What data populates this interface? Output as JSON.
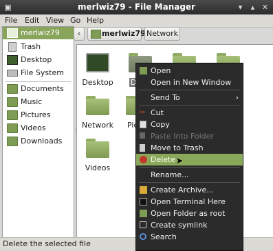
{
  "window": {
    "title": "merlwiz79 - File Manager"
  },
  "menubar": {
    "items": [
      "File",
      "Edit",
      "View",
      "Go",
      "Help"
    ]
  },
  "sidebar": {
    "places": [
      {
        "label": "merlwiz79",
        "icon": "home-icon",
        "selected": true
      },
      {
        "label": "Trash",
        "icon": "trash-icon"
      },
      {
        "label": "Desktop",
        "icon": "desktop-icon"
      },
      {
        "label": "File System",
        "icon": "drive-icon"
      }
    ],
    "bookmarks": [
      {
        "label": "Documents",
        "icon": "folder-icon"
      },
      {
        "label": "Music",
        "icon": "folder-icon"
      },
      {
        "label": "Pictures",
        "icon": "folder-icon"
      },
      {
        "label": "Videos",
        "icon": "folder-icon"
      },
      {
        "label": "Downloads",
        "icon": "folder-icon"
      }
    ]
  },
  "toolbar": {
    "back_icon": "chevron-left-icon",
    "path_current": "merlwiz79",
    "path_other": "Network"
  },
  "main": {
    "items": [
      {
        "label": "Desktop",
        "icon": "desktop-icon"
      },
      {
        "label": "Docu",
        "icon": "folder-icon"
      },
      {
        "label": "",
        "icon": "folder-icon"
      },
      {
        "label": "",
        "icon": "folder-icon"
      },
      {
        "label": "Network",
        "icon": "folder-icon"
      },
      {
        "label": "Pic",
        "icon": "folder-icon"
      },
      {
        "label": "s",
        "icon": "folder-icon"
      },
      {
        "label": "Videos",
        "icon": "folder-icon"
      }
    ]
  },
  "context_menu": {
    "items": [
      {
        "label": "Open",
        "icon": "folder-icon"
      },
      {
        "label": "Open in New Window",
        "icon": ""
      },
      {
        "separator": true
      },
      {
        "label": "Send To",
        "icon": "",
        "submenu": true
      },
      {
        "separator": true
      },
      {
        "label": "Cut",
        "icon": "scissors-icon"
      },
      {
        "label": "Copy",
        "icon": "copy-icon"
      },
      {
        "label": "Paste Into Folder",
        "icon": "paste-icon",
        "disabled": true
      },
      {
        "label": "Move to Trash",
        "icon": "trash-icon"
      },
      {
        "label": "Delete",
        "icon": "delete-icon",
        "highlighted": true
      },
      {
        "separator": true
      },
      {
        "label": "Rename...",
        "icon": ""
      },
      {
        "separator": true
      },
      {
        "label": "Create Archive...",
        "icon": "archive-icon"
      },
      {
        "label": "Open Terminal Here",
        "icon": "terminal-icon"
      },
      {
        "label": "Open Folder as root",
        "icon": "folder-icon"
      },
      {
        "label": "Create symlink",
        "icon": "link-icon"
      },
      {
        "label": "Search",
        "icon": "search-icon"
      }
    ]
  },
  "statusbar": {
    "text": "Delete the selected file"
  },
  "colors": {
    "accent": "#8aa85a",
    "folder": "#7f9c54",
    "menu_bg": "#2b2b2b",
    "titlebar": "#3a3a3a"
  }
}
